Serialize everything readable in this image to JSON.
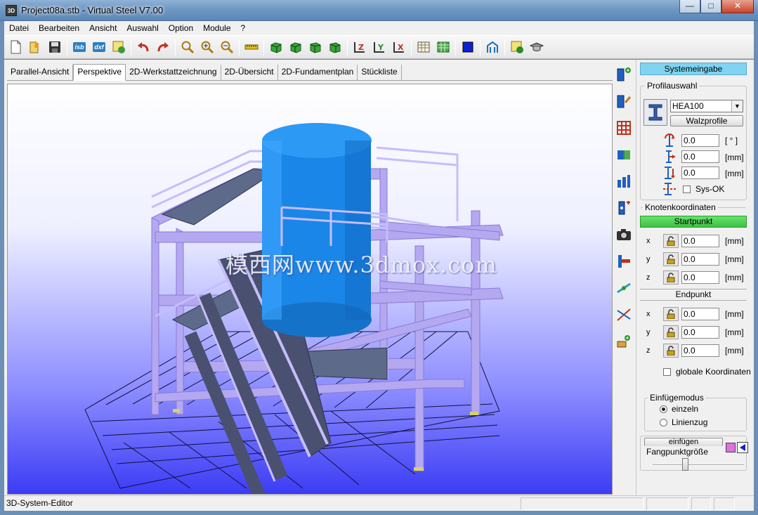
{
  "window": {
    "title": "Project08a.stb  - Virtual Steel V7.00",
    "app_icon": "3D",
    "buttons": [
      "minimize",
      "maximize",
      "close"
    ]
  },
  "menu": [
    "Datei",
    "Bearbeiten",
    "Ansicht",
    "Auswahl",
    "Option",
    "Module",
    "?"
  ],
  "toolbar": {
    "isb_label": "isb",
    "dxf_label": "dxf"
  },
  "tabs": [
    {
      "label": "Parallel-Ansicht",
      "active": false
    },
    {
      "label": "Perspektive",
      "active": true
    },
    {
      "label": "2D-Werkstattzeichnung",
      "active": false
    },
    {
      "label": "2D-Übersicht",
      "active": false
    },
    {
      "label": "2D-Fundamentplan",
      "active": false
    },
    {
      "label": "Stückliste",
      "active": false
    }
  ],
  "viewport": {
    "watermark": "模西网www.3dmox.com"
  },
  "panel": {
    "header": "Systemeingabe",
    "profile": {
      "legend": "Profilauswahl",
      "selected": "HEA100",
      "type_button": "Walzprofile",
      "rotation": {
        "value": "0.0",
        "unit": "[ ° ]"
      },
      "offset1": {
        "value": "0.0",
        "unit": "[mm]"
      },
      "offset2": {
        "value": "0.0",
        "unit": "[mm]"
      },
      "sys_ok_label": "Sys-OK",
      "sys_ok_checked": false
    },
    "coords": {
      "legend": "Knotenkoordinaten",
      "start_label": "Startpunkt",
      "start": [
        {
          "axis": "x",
          "value": "0.0",
          "unit": "[mm]"
        },
        {
          "axis": "y",
          "value": "0.0",
          "unit": "[mm]"
        },
        {
          "axis": "z",
          "value": "0.0",
          "unit": "[mm]"
        }
      ],
      "end_label": "Endpunkt",
      "end": [
        {
          "axis": "x",
          "value": "0.0",
          "unit": "[mm]"
        },
        {
          "axis": "y",
          "value": "0.0",
          "unit": "[mm]"
        },
        {
          "axis": "z",
          "value": "0.0",
          "unit": "[mm]"
        }
      ],
      "global_label": "globale Koordinaten",
      "global_checked": false
    },
    "insert": {
      "legend": "Einfügemodus",
      "options": [
        {
          "label": "einzeln",
          "selected": true
        },
        {
          "label": "Linienzug",
          "selected": false
        }
      ],
      "button": "einfügen",
      "snap_label": "Fangpunktgröße",
      "snap_level": 0.35
    }
  },
  "status": {
    "text": "3D-System-Editor"
  },
  "colors": {
    "header_accent": "#7fd4f2",
    "start_bar": "#4fd154",
    "tank": "#1a86e8",
    "steel": "#b4a8f0"
  }
}
